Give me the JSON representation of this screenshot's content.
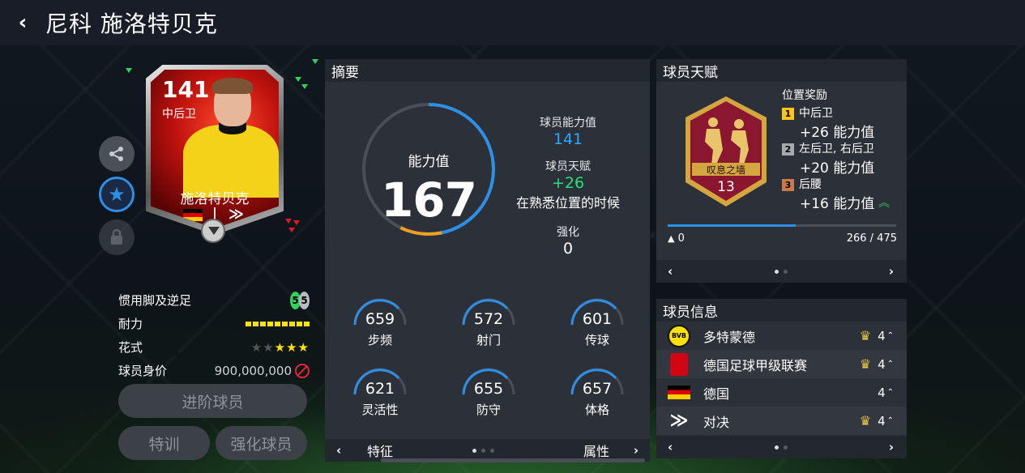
{
  "header": {
    "back_icon": "chevron-left-icon",
    "title": "尼科 施洛特贝克"
  },
  "card": {
    "ovr": "141",
    "position": "中后卫",
    "name": "施洛特贝克",
    "nation": "德国",
    "colors": {
      "frame": "#9a9a9a",
      "inner": "#c0120e",
      "jersey": "#f4d21a"
    }
  },
  "side_buttons": {
    "share_icon": "share-icon",
    "favorite_icon": "star-icon",
    "lock_icon": "lock-icon"
  },
  "player_stats": {
    "foot_label": "惯用脚及逆足",
    "foot_left": "5",
    "foot_right": "5",
    "stamina_label": "耐力",
    "skill_label": "花式",
    "skill_stars": 3,
    "skill_stars_max": 5,
    "value_label": "球员身价",
    "value": "900,000,000"
  },
  "buttons": {
    "advance": "进阶球员",
    "training": "特训",
    "strengthen": "强化球员"
  },
  "summary": {
    "title": "摘要",
    "ovr_label": "能力值",
    "ovr_value": "167",
    "player_ovr_label": "球员能力值",
    "player_ovr_value": "141",
    "talent_label": "球员天赋",
    "talent_value": "+26",
    "talent_note": "在熟悉位置的时候",
    "boost_label": "强化",
    "boost_value": "0",
    "attributes": [
      {
        "name": "步频",
        "value": "659"
      },
      {
        "name": "射门",
        "value": "572"
      },
      {
        "name": "传球",
        "value": "601"
      },
      {
        "name": "灵活性",
        "value": "621"
      },
      {
        "name": "防守",
        "value": "655"
      },
      {
        "name": "体格",
        "value": "657"
      }
    ],
    "footer_left": "特征",
    "footer_right": "属性"
  },
  "talent": {
    "title": "球员天赋",
    "badge_name": "叹息之墙",
    "badge_level": "13",
    "bonus_title": "位置奖励",
    "bonuses": [
      {
        "rank": "1",
        "positions": "中后卫",
        "bonus": "+26 能力值"
      },
      {
        "rank": "2",
        "positions": "左后卫, 右后卫",
        "bonus": "+20 能力值"
      },
      {
        "rank": "3",
        "positions": "后腰",
        "bonus": "+16 能力值"
      }
    ],
    "progress_left": "0",
    "progress_right": "266 / 475",
    "progress_fraction": 0.56
  },
  "info": {
    "title": "球员信息",
    "rows": [
      {
        "name": "多特蒙德",
        "value": "4",
        "logo": "bvb-logo"
      },
      {
        "name": "德国足球甲级联赛",
        "value": "4",
        "logo": "bundesliga-logo"
      },
      {
        "name": "德国",
        "value": "4",
        "logo": "germany-flag"
      },
      {
        "name": "对决",
        "value": "4",
        "logo": "showdown-logo"
      }
    ]
  },
  "colors": {
    "accent_blue": "#2d8fe6",
    "accent_green": "#27e07a",
    "ring_orange": "#f0a020",
    "stamina_yellow": "#ffe400"
  }
}
